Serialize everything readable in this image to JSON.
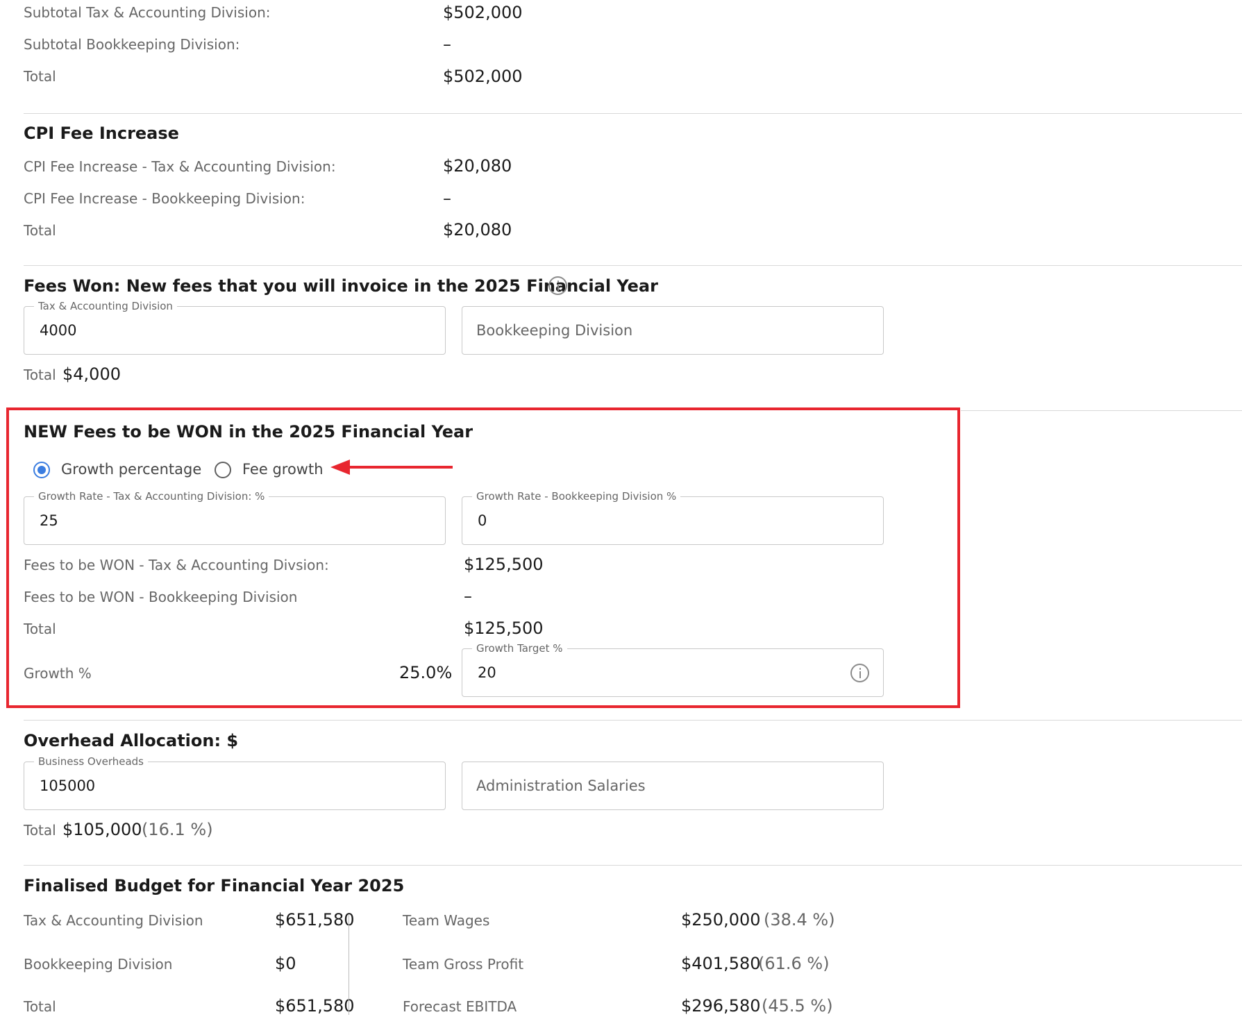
{
  "subtotals": {
    "tax_label": "Subtotal Tax & Accounting Division:",
    "tax_value": "$502,000",
    "bk_label": "Subtotal Bookkeeping Division:",
    "bk_value": "–",
    "total_label": "Total",
    "total_value": "$502,000"
  },
  "cpi": {
    "heading": "CPI Fee Increase",
    "tax_label": "CPI Fee Increase - Tax & Accounting Division:",
    "tax_value": "$20,080",
    "bk_label": "CPI Fee Increase - Bookkeeping Division:",
    "bk_value": "–",
    "total_label": "Total",
    "total_value": "$20,080"
  },
  "fees_won": {
    "heading": "Fees Won: New fees that you will invoice in the 2025 Financial Year",
    "tax_field_label": "Tax & Accounting Division",
    "tax_field_value": "4000",
    "bk_field_placeholder": "Bookkeeping Division",
    "total_label": "Total",
    "total_value": "$4,000"
  },
  "new_fees": {
    "heading": "NEW Fees to be WON in the 2025 Financial Year",
    "radio_growth_pct": "Growth percentage",
    "radio_fee_growth": "Fee growth",
    "selected_option": "Growth percentage",
    "tax_rate_label": "Growth Rate - Tax & Accounting Division: %",
    "tax_rate_value": "25",
    "bk_rate_label": "Growth Rate - Bookkeeping Division %",
    "bk_rate_value": "0",
    "tax_won_label": "Fees to be WON - Tax & Accounting Divsion:",
    "tax_won_value": "$125,500",
    "bk_won_label": "Fees to be WON - Bookkeeping Division",
    "bk_won_value": "–",
    "total_label": "Total",
    "total_value": "$125,500",
    "growth_label": "Growth %",
    "growth_value": "25.0%",
    "target_label": "Growth Target %",
    "target_value": "20",
    "highlight_color": "#e8262f"
  },
  "overhead": {
    "heading": "Overhead Allocation: $",
    "business_label": "Business Overheads",
    "business_value": "105000",
    "admin_placeholder": "Administration Salaries",
    "total_label": "Total",
    "total_value": "$105,000",
    "total_pct": "(16.1 %)"
  },
  "budget": {
    "heading": "Finalised Budget for Financial Year 2025",
    "tax_label": "Tax & Accounting Division",
    "tax_value": "$651,580",
    "bk_label": "Bookkeeping Division",
    "bk_value": "$0",
    "total_label": "Total",
    "total_value": "$651,580",
    "wages_label": "Team Wages",
    "wages_value": "$250,000",
    "wages_pct": "(38.4 %)",
    "gross_label": "Team Gross Profit",
    "gross_value": "$401,580",
    "gross_pct": "(61.6 %)",
    "ebitda_label": "Forecast EBITDA",
    "ebitda_value": "$296,580",
    "ebitda_pct": "(45.5 %)"
  },
  "icons": {
    "info": "info-icon",
    "arrow": "red-arrow-annotation"
  }
}
